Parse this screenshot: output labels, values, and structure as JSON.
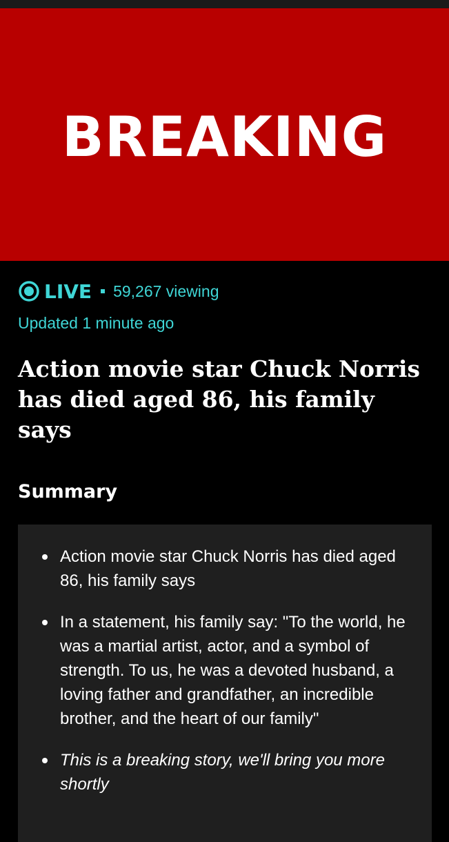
{
  "banner": {
    "label": "BREAKING",
    "color": "#b80000"
  },
  "live": {
    "icon": "live-broadcast-icon",
    "label": "LIVE",
    "viewers": "59,267 viewing",
    "updated": "Updated 1 minute ago",
    "accent_color": "#3fd6d6"
  },
  "article": {
    "headline": "Action movie star Chuck Norris has died aged 86, his family says"
  },
  "summary": {
    "heading": "Summary",
    "items": [
      {
        "text": "Action movie star Chuck Norris has died aged 86, his family says",
        "italic": false
      },
      {
        "text": "In a statement, his family say: \"To the world, he was a martial artist, actor, and a symbol of strength. To us, he was a devoted husband, a loving father and grandfather, an incredible brother, and the heart of our family\"",
        "italic": false
      },
      {
        "text": "This is a breaking story, we'll bring you more shortly",
        "italic": true
      }
    ]
  }
}
